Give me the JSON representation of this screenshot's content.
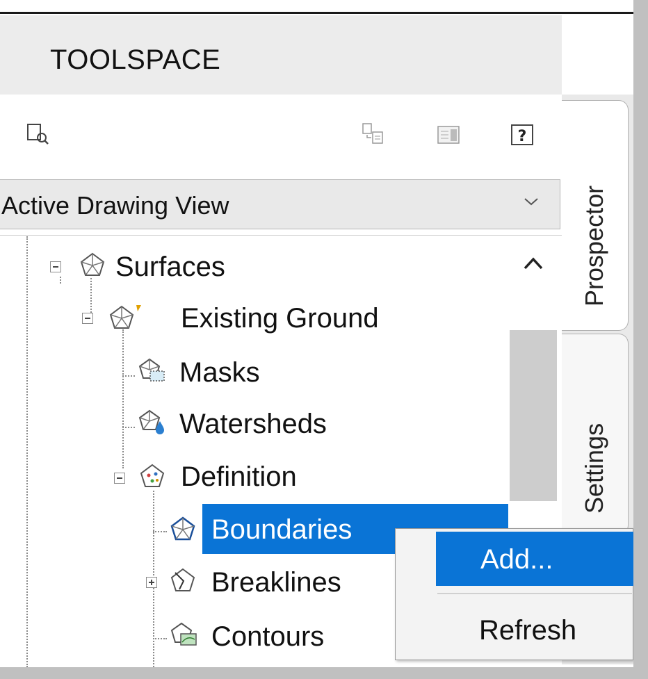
{
  "toolspace": {
    "title": "TOOLSPACE"
  },
  "toolbar": {
    "icons": [
      "item-view-icon",
      "copy-icon",
      "panel-icon",
      "help-icon"
    ],
    "help_glyph": "?"
  },
  "view_selector": {
    "selected": "Active Drawing View"
  },
  "tree": {
    "nodes": [
      {
        "label": "Surfaces",
        "icon": "surface-icon",
        "expanded": true
      },
      {
        "label": "Existing Ground",
        "icon": "surface-icon",
        "expanded": true
      },
      {
        "label": "Masks",
        "icon": "mask-icon"
      },
      {
        "label": "Watersheds",
        "icon": "watershed-icon"
      },
      {
        "label": "Definition",
        "icon": "definition-icon",
        "expanded": true
      },
      {
        "label": "Boundaries",
        "icon": "boundary-icon",
        "selected": true
      },
      {
        "label": "Breaklines",
        "icon": "breakline-icon",
        "expanded": false
      },
      {
        "label": "Contours",
        "icon": "contour-icon"
      }
    ]
  },
  "tabs": {
    "items": [
      "Prospector",
      "Settings"
    ],
    "active": "Prospector"
  },
  "context_menu": {
    "items": [
      "Add...",
      "Refresh"
    ],
    "highlighted": "Add..."
  },
  "colors": {
    "selection": "#0a74d6",
    "panel_bg": "#ececec"
  }
}
